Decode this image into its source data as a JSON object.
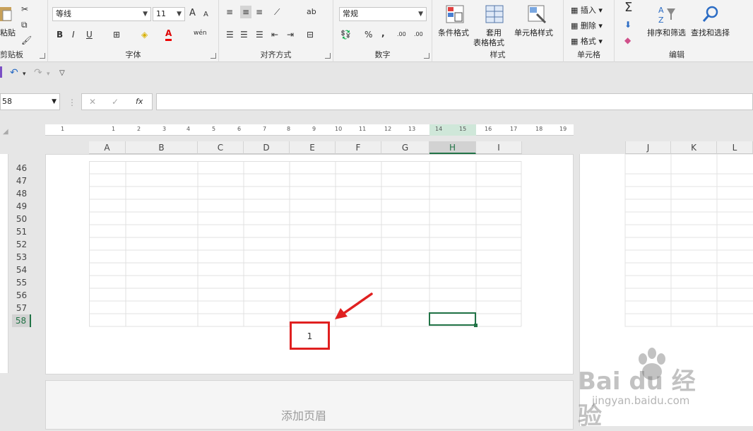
{
  "clipboard": {
    "paste_label": "粘贴",
    "group_label": "剪贴板"
  },
  "font": {
    "name": "等线",
    "size": "11",
    "group_label": "字体",
    "bold": "B",
    "italic": "I",
    "underline": "U",
    "grow": "A",
    "shrink": "A",
    "font_color": "A",
    "phonetic": "wén"
  },
  "alignment": {
    "group_label": "对齐方式",
    "wrap_icon": "ab"
  },
  "number": {
    "format": "常规",
    "group_label": "数字",
    "percent": "%",
    "comma": ",",
    "inc_decimal": ".00",
    "dec_decimal": ".00"
  },
  "styles": {
    "group_label": "样式",
    "conditional": "条件格式",
    "table_format_1": "套用",
    "table_format_2": "表格格式",
    "cell_styles": "单元格样式"
  },
  "cells": {
    "group_label": "单元格",
    "insert": "插入",
    "delete": "删除",
    "format": "格式"
  },
  "editing": {
    "group_label": "编辑",
    "sum_icon": "Σ",
    "sort_filter": "排序和筛选",
    "find_select": "查找和选择"
  },
  "namebox": "58",
  "formula_fx": "fx",
  "ruler_numbers": [
    "1",
    "1",
    "2",
    "3",
    "4",
    "5",
    "6",
    "7",
    "8",
    "9",
    "10",
    "11",
    "12",
    "13",
    "14",
    "15",
    "16",
    "17",
    "18",
    "19"
  ],
  "columns": [
    "A",
    "B",
    "C",
    "D",
    "E",
    "F",
    "G",
    "H",
    "I"
  ],
  "right_columns": [
    "J",
    "K",
    "L"
  ],
  "rows": [
    "46",
    "47",
    "48",
    "49",
    "50",
    "51",
    "52",
    "53",
    "54",
    "55",
    "56",
    "57",
    "58"
  ],
  "page_number": "1",
  "add_header": "添加页眉",
  "watermark": {
    "brand": "Bai du 经验",
    "url": "jingyan.baidu.com"
  },
  "colors": {
    "accent": "#217346",
    "annotation": "#e02020"
  }
}
